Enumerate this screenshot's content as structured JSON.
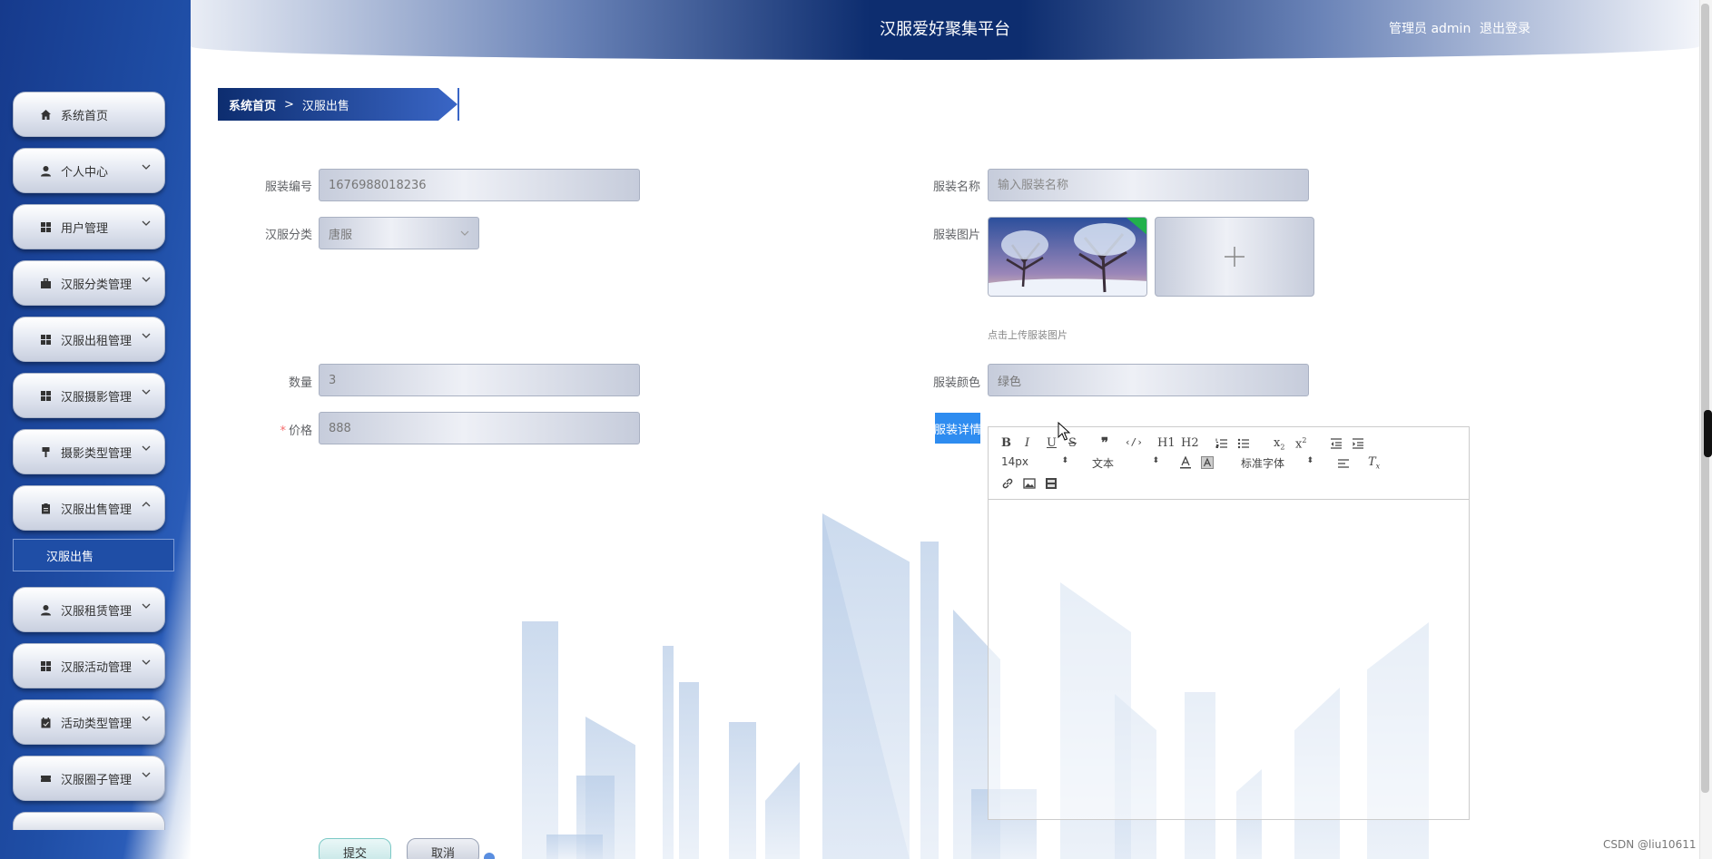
{
  "header": {
    "title": "汉服爱好聚集平台",
    "user": "管理员 admin",
    "logout": "退出登录"
  },
  "sidebar": {
    "items": [
      {
        "label": "系统首页",
        "icon": "home-icon"
      },
      {
        "label": "个人中心",
        "icon": "user-icon"
      },
      {
        "label": "用户管理",
        "icon": "grid-icon"
      },
      {
        "label": "汉服分类管理",
        "icon": "briefcase-icon"
      },
      {
        "label": "汉服出租管理",
        "icon": "grid-icon"
      },
      {
        "label": "汉服摄影管理",
        "icon": "grid-icon"
      },
      {
        "label": "摄影类型管理",
        "icon": "pin-icon"
      },
      {
        "label": "汉服出售管理",
        "icon": "clipboard-icon"
      },
      {
        "label": "汉服租赁管理",
        "icon": "user-icon"
      },
      {
        "label": "汉服活动管理",
        "icon": "grid-icon"
      },
      {
        "label": "活动类型管理",
        "icon": "calendar-icon"
      },
      {
        "label": "汉服圈子管理",
        "icon": "ticket-icon"
      }
    ],
    "submenu": "汉服出售"
  },
  "breadcrumb": {
    "home": "系统首页",
    "separator": ">",
    "current": "汉服出售"
  },
  "form": {
    "code_label": "服装编号",
    "code_value": "1676988018236",
    "name_label": "服装名称",
    "name_placeholder": "输入服装名称",
    "category_label": "汉服分类",
    "category_value": "唐服",
    "image_label": "服装图片",
    "image_hint": "点击上传服装图片",
    "quantity_label": "数量",
    "quantity_value": "3",
    "color_label": "服装颜色",
    "color_value": "绿色",
    "price_label": "价格",
    "price_required": "*",
    "price_value": "888",
    "detail_label": "服装详情"
  },
  "editor": {
    "font_size": "14px",
    "text_type": "文本",
    "font_family": "标准字体",
    "buttons": {
      "bold": "B",
      "italic": "I",
      "underline": "U",
      "strike": "S",
      "h1": "H1",
      "h2": "H2"
    }
  },
  "actions": {
    "submit": "提交",
    "cancel": "取消"
  },
  "watermark": "CSDN @liu10611",
  "colors": {
    "primary": "#0d2d6f",
    "accent": "#2e8cf0",
    "required": "#f56c6c"
  }
}
